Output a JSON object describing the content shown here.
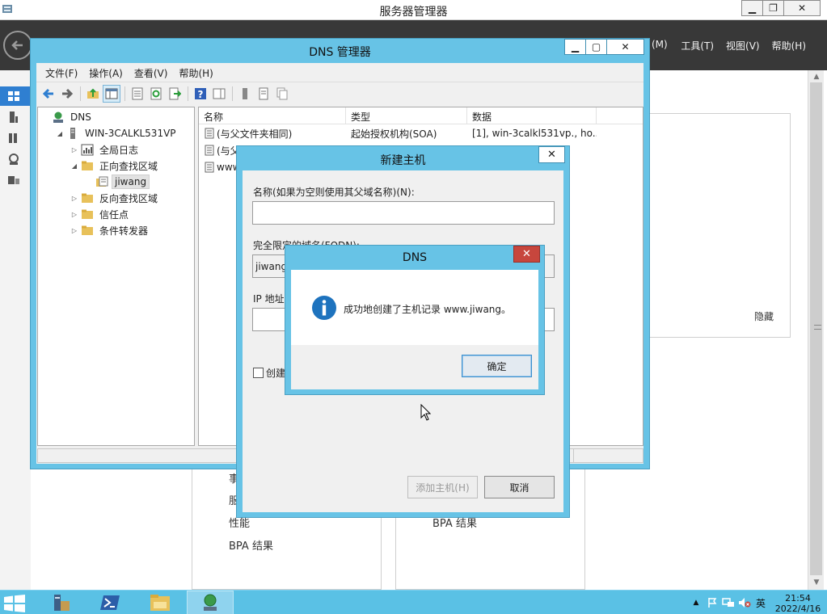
{
  "server_manager": {
    "title": "服务器管理器",
    "menu": [
      "工具(T)",
      "视图(V)",
      "帮助(H)"
    ],
    "menu_partial": "(M)",
    "hide_label": "隐藏",
    "tile_left": [
      "事",
      "服",
      "性能",
      "BPA 结果"
    ],
    "tile_right": [
      "BPA 结果"
    ]
  },
  "dns_manager": {
    "title": "DNS 管理器",
    "menu": [
      "文件(F)",
      "操作(A)",
      "查看(V)",
      "帮助(H)"
    ],
    "tree": [
      {
        "label": "DNS",
        "indent": 0,
        "expander": "",
        "icon": "dns-icon"
      },
      {
        "label": "WIN-3CALKL531VP",
        "indent": 1,
        "expander": "◢",
        "icon": "server-icon"
      },
      {
        "label": "全局日志",
        "indent": 2,
        "expander": "▷",
        "icon": "log-icon"
      },
      {
        "label": "正向查找区域",
        "indent": 2,
        "expander": "◢",
        "icon": "folder-icon"
      },
      {
        "label": "jiwang",
        "indent": 3,
        "expander": "",
        "icon": "zone-icon",
        "selected": true
      },
      {
        "label": "反向查找区域",
        "indent": 2,
        "expander": "▷",
        "icon": "folder-icon"
      },
      {
        "label": "信任点",
        "indent": 2,
        "expander": "▷",
        "icon": "folder-icon"
      },
      {
        "label": "条件转发器",
        "indent": 2,
        "expander": "▷",
        "icon": "folder-icon"
      }
    ],
    "columns": [
      "名称",
      "类型",
      "数据"
    ],
    "rows": [
      {
        "name": "(与父文件夹相同)",
        "type": "起始授权机构(SOA)",
        "data": "[1], win-3calkl531vp., ho..."
      },
      {
        "name": "(与父",
        "type": "",
        "data": ""
      },
      {
        "name": "www",
        "type": "",
        "data": ""
      }
    ]
  },
  "new_host": {
    "title": "新建主机",
    "name_label": "名称(如果为空则使用其父域名称)(N):",
    "name_value": "",
    "fqdn_label": "完全限定的域名(FQDN):",
    "fqdn_value": "jiwang",
    "ip_label": "IP 地址",
    "ip_value": "",
    "create_ptr_label": "创建",
    "add_host_button": "添加主机(H)",
    "cancel_button": "取消"
  },
  "message_box": {
    "title": "DNS",
    "message": "成功地创建了主机记录 www.jiwang。",
    "ok_button": "确定"
  },
  "taskbar": {
    "time": "21:54",
    "date": "2022/4/16",
    "ime": "英"
  },
  "colors": {
    "window_frame": "#67c3e6",
    "taskbar": "#5ac1e5",
    "header": "#383838",
    "close_red": "#c7463d",
    "info_blue": "#1e73be"
  }
}
